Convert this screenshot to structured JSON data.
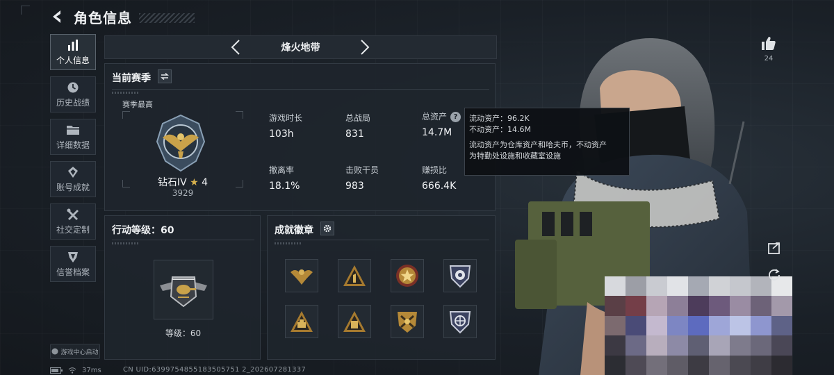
{
  "header": {
    "title": "角色信息"
  },
  "sidebar": {
    "items": [
      {
        "label": "个人信息",
        "icon": "bar-chart-icon",
        "active": true
      },
      {
        "label": "历史战绩",
        "icon": "clock-icon"
      },
      {
        "label": "详细数据",
        "icon": "folder-icon"
      },
      {
        "label": "账号成就",
        "icon": "achievement-icon"
      },
      {
        "label": "社交定制",
        "icon": "tools-icon"
      },
      {
        "label": "信誉档案",
        "icon": "shield-icon"
      }
    ],
    "launch_label": "游戏中心启动"
  },
  "mode": {
    "name": "烽火地带"
  },
  "season": {
    "title": "当前赛季",
    "highest_label": "赛季最高",
    "rank_name": "钻石IV",
    "rank_stars": "4",
    "rank_points": "3929",
    "stats": [
      {
        "label": "游戏时长",
        "value": "103h"
      },
      {
        "label": "总战局",
        "value": "831"
      },
      {
        "label": "总资产",
        "value": "14.7M"
      },
      {
        "label": "撤离率",
        "value": "18.1%"
      },
      {
        "label": "击败干员",
        "value": "983"
      },
      {
        "label": "赚损比",
        "value": "666.4K"
      }
    ]
  },
  "tooltip": {
    "line1": "流动资产：96.2K",
    "line2": "不动资产：14.6M",
    "line3": "流动资产为仓库资产和哈夫币，不动资产",
    "line4": "为特勤处设施和收藏室设施"
  },
  "action_level": {
    "title": "行动等级：60",
    "level_label": "等级：60"
  },
  "achievements": {
    "title": "成就徽章",
    "badges": [
      "eagle-badge-icon",
      "triangle-one-badge-icon",
      "star-medal-icon",
      "shield-badge-icon",
      "triangle-tower-badge-icon",
      "triangle-block-badge-icon",
      "crossed-arms-badge-icon",
      "globe-badge-icon"
    ]
  },
  "right": {
    "likes": "24"
  },
  "status": {
    "ping": "37ms",
    "uid": "CN UID:6399754855183505751 2_202607281337"
  },
  "colors": {
    "background": "#171c22",
    "panel": "#1e252d",
    "accent_gold": "#c9a24a",
    "text": "#f0f2f4"
  }
}
